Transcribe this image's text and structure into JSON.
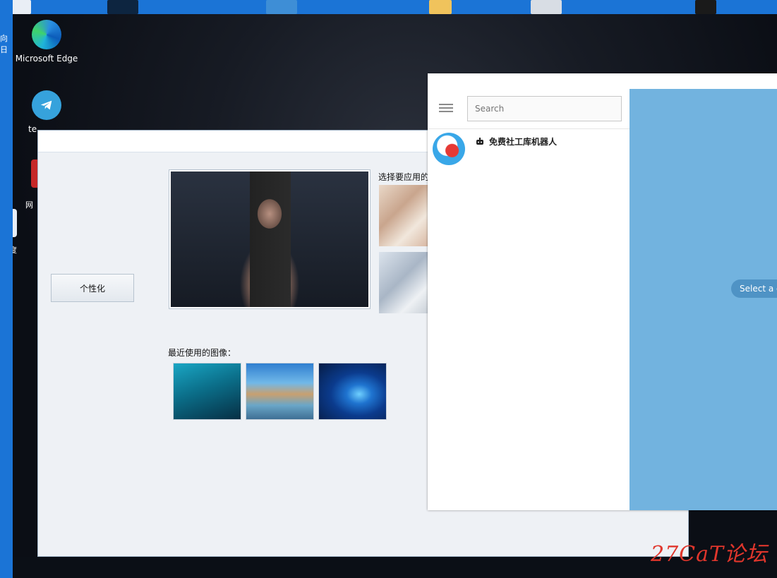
{
  "desktop": {
    "icons": [
      {
        "label": "Microsoft Edge"
      },
      {
        "label": "te"
      },
      {
        "label": "网"
      },
      {
        "label": "百度"
      }
    ],
    "left_fragment": "向日"
  },
  "personalize_dialog": {
    "personalize_button": "个性化",
    "choose_label": "选择要应用的",
    "recent_label": "最近使用的图像："
  },
  "telegram": {
    "search_placeholder": "Search",
    "chat": {
      "title": "免费社工库机器人",
      "badge_icon": "bot-icon"
    },
    "select_hint": "Select a chat to start messaging"
  },
  "taskbar": {
    "items": [
      "start-icon",
      "settings-icon",
      "telegram-icon"
    ],
    "tray": [
      "wifi-icon",
      "volume-icon"
    ]
  },
  "watermark": "27CaT论坛"
}
